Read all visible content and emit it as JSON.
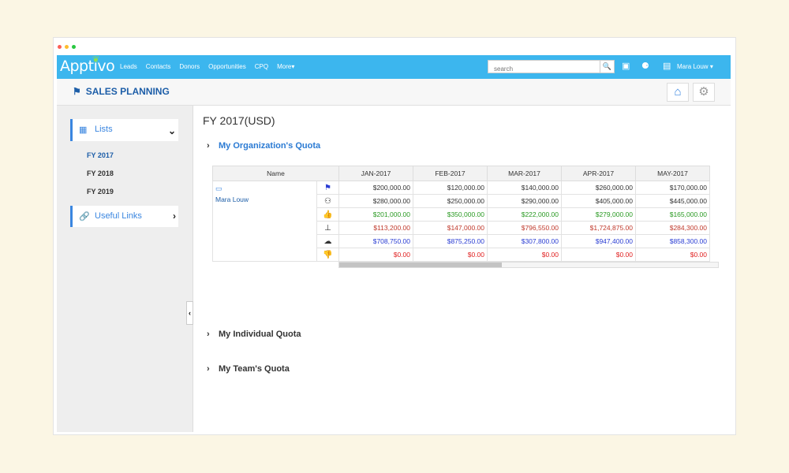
{
  "app": {
    "logo": "Apptivo",
    "nav": [
      "Leads",
      "Contacts",
      "Donors",
      "Opportunities",
      "CPQ",
      "More"
    ],
    "search_placeholder": "search",
    "user": "Mara Louw",
    "accent": "#3cb6ee"
  },
  "page": {
    "title": "SALES PLANNING"
  },
  "sidebar": {
    "lists_label": "Lists",
    "fiscal_years": [
      "FY 2017",
      "FY 2018",
      "FY 2019"
    ],
    "active_year": "FY 2017",
    "useful_links_label": "Useful Links"
  },
  "main": {
    "fy_title": "FY 2017(USD)",
    "org_quota": "My Organization's Quota",
    "individual_quota": "My Individual Quota",
    "team_quota": "My Team's Quota"
  },
  "table": {
    "name_header": "Name",
    "owner": "Mara Louw",
    "months": [
      "JAN-2017",
      "FEB-2017",
      "MAR-2017",
      "APR-2017",
      "MAY-2017"
    ],
    "rows": [
      {
        "icon": "flag-icon",
        "color": "black",
        "values": [
          "$200,000.00",
          "$120,000.00",
          "$140,000.00",
          "$260,000.00",
          "$170,000.00"
        ]
      },
      {
        "icon": "handshake-icon",
        "color": "black",
        "values": [
          "$280,000.00",
          "$250,000.00",
          "$290,000.00",
          "$405,000.00",
          "$445,000.00"
        ]
      },
      {
        "icon": "thumbs-up-icon",
        "color": "green",
        "values": [
          "$201,000.00",
          "$350,000.00",
          "$222,000.00",
          "$279,000.00",
          "$165,000.00"
        ]
      },
      {
        "icon": "tap-icon",
        "color": "red",
        "values": [
          "$113,200.00",
          "$147,000.00",
          "$796,550.00",
          "$1,724,875.00",
          "$284,300.00"
        ]
      },
      {
        "icon": "weather-icon",
        "color": "blue",
        "values": [
          "$708,750.00",
          "$875,250.00",
          "$307,800.00",
          "$947,400.00",
          "$858,300.00"
        ]
      },
      {
        "icon": "thumbs-down-icon",
        "color": "bright",
        "values": [
          "$0.00",
          "$0.00",
          "$0.00",
          "$0.00",
          "$0.00"
        ]
      }
    ],
    "scroll_fraction": 0.43
  }
}
